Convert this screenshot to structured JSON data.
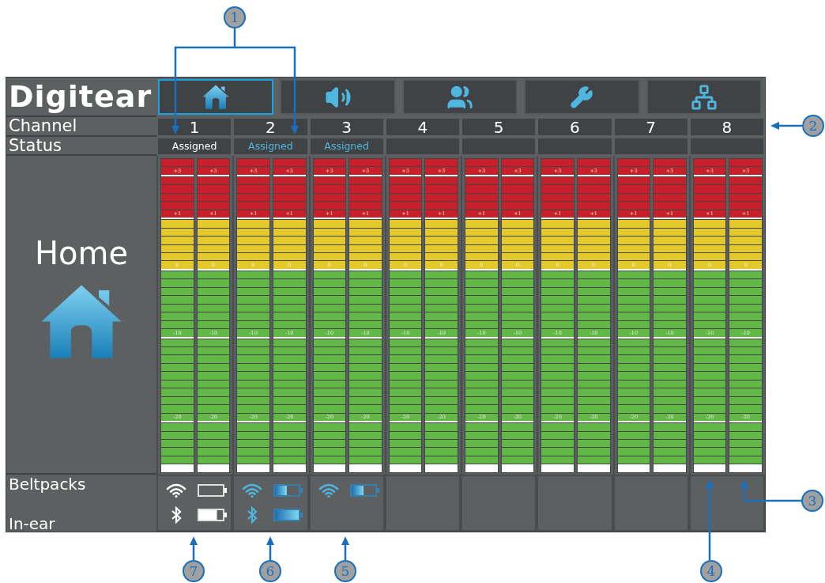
{
  "logo": {
    "text": "Digitear"
  },
  "tabs": [
    {
      "selected": true
    },
    {
      "selected": false
    },
    {
      "selected": false
    },
    {
      "selected": false
    },
    {
      "selected": false
    }
  ],
  "row_labels": {
    "channel": "Channel",
    "status": "Status",
    "page": "Home",
    "beltpacks": "Beltpacks",
    "in_ear": "In-ear"
  },
  "channels": [
    {
      "number": "1",
      "status": {
        "text": "Assigned",
        "highlighted": false
      },
      "meters": [
        {
          "scale": [
            "+3",
            "+1",
            "0",
            "-10",
            "-20"
          ]
        },
        {
          "scale": [
            "+3",
            "+1",
            "0",
            "-10",
            "-20"
          ]
        }
      ],
      "beltpack": {
        "highlighted": false,
        "battery": {
          "kind": "empty"
        }
      },
      "in_ear": {
        "highlighted": false,
        "battery": {
          "kind": "high"
        }
      }
    },
    {
      "number": "2",
      "status": {
        "text": "Assigned",
        "highlighted": true
      },
      "meters": [
        {
          "scale": [
            "+3",
            "+1",
            "0",
            "-10",
            "-20"
          ]
        },
        {
          "scale": [
            "+3",
            "+1",
            "0",
            "-10",
            "-20"
          ]
        }
      ],
      "beltpack": {
        "highlighted": true,
        "battery": {
          "kind": "half"
        }
      },
      "in_ear": {
        "highlighted": true,
        "battery": {
          "kind": "full"
        }
      }
    },
    {
      "number": "3",
      "status": {
        "text": "Assigned",
        "highlighted": true
      },
      "meters": [
        {
          "scale": [
            "+3",
            "+1",
            "0",
            "-10",
            "-20"
          ]
        },
        {
          "scale": [
            "+3",
            "+1",
            "0",
            "-10",
            "-20"
          ]
        }
      ],
      "beltpack": {
        "highlighted": true,
        "battery": {
          "kind": "half"
        }
      }
    },
    {
      "number": "4",
      "meters": [
        {
          "scale": [
            "+3",
            "+1",
            "0",
            "-10",
            "-20"
          ]
        },
        {
          "scale": [
            "+3",
            "+1",
            "0",
            "-10",
            "-20"
          ]
        }
      ]
    },
    {
      "number": "5",
      "meters": [
        {
          "scale": [
            "+3",
            "+1",
            "0",
            "-10",
            "-20"
          ]
        },
        {
          "scale": [
            "+3",
            "+1",
            "0",
            "-10",
            "-20"
          ]
        }
      ]
    },
    {
      "number": "6",
      "meters": [
        {
          "scale": [
            "+3",
            "+1",
            "0",
            "-10",
            "-20"
          ]
        },
        {
          "scale": [
            "+3",
            "+1",
            "0",
            "-10",
            "-20"
          ]
        }
      ]
    },
    {
      "number": "7",
      "meters": [
        {
          "scale": [
            "+3",
            "+1",
            "0",
            "-10",
            "-20"
          ]
        },
        {
          "scale": [
            "+3",
            "+1",
            "0",
            "-10",
            "-20"
          ]
        }
      ]
    },
    {
      "number": "8",
      "meters": [
        {
          "scale": [
            "+3",
            "+1",
            "0",
            "-10",
            "-20"
          ]
        },
        {
          "scale": [
            "+3",
            "+1",
            "0",
            "-10",
            "-20"
          ]
        }
      ]
    }
  ],
  "callouts": [
    {
      "number": "1"
    },
    {
      "number": "2"
    },
    {
      "number": "3"
    },
    {
      "number": "7"
    },
    {
      "number": "6"
    },
    {
      "number": "5"
    },
    {
      "number": "4"
    }
  ]
}
